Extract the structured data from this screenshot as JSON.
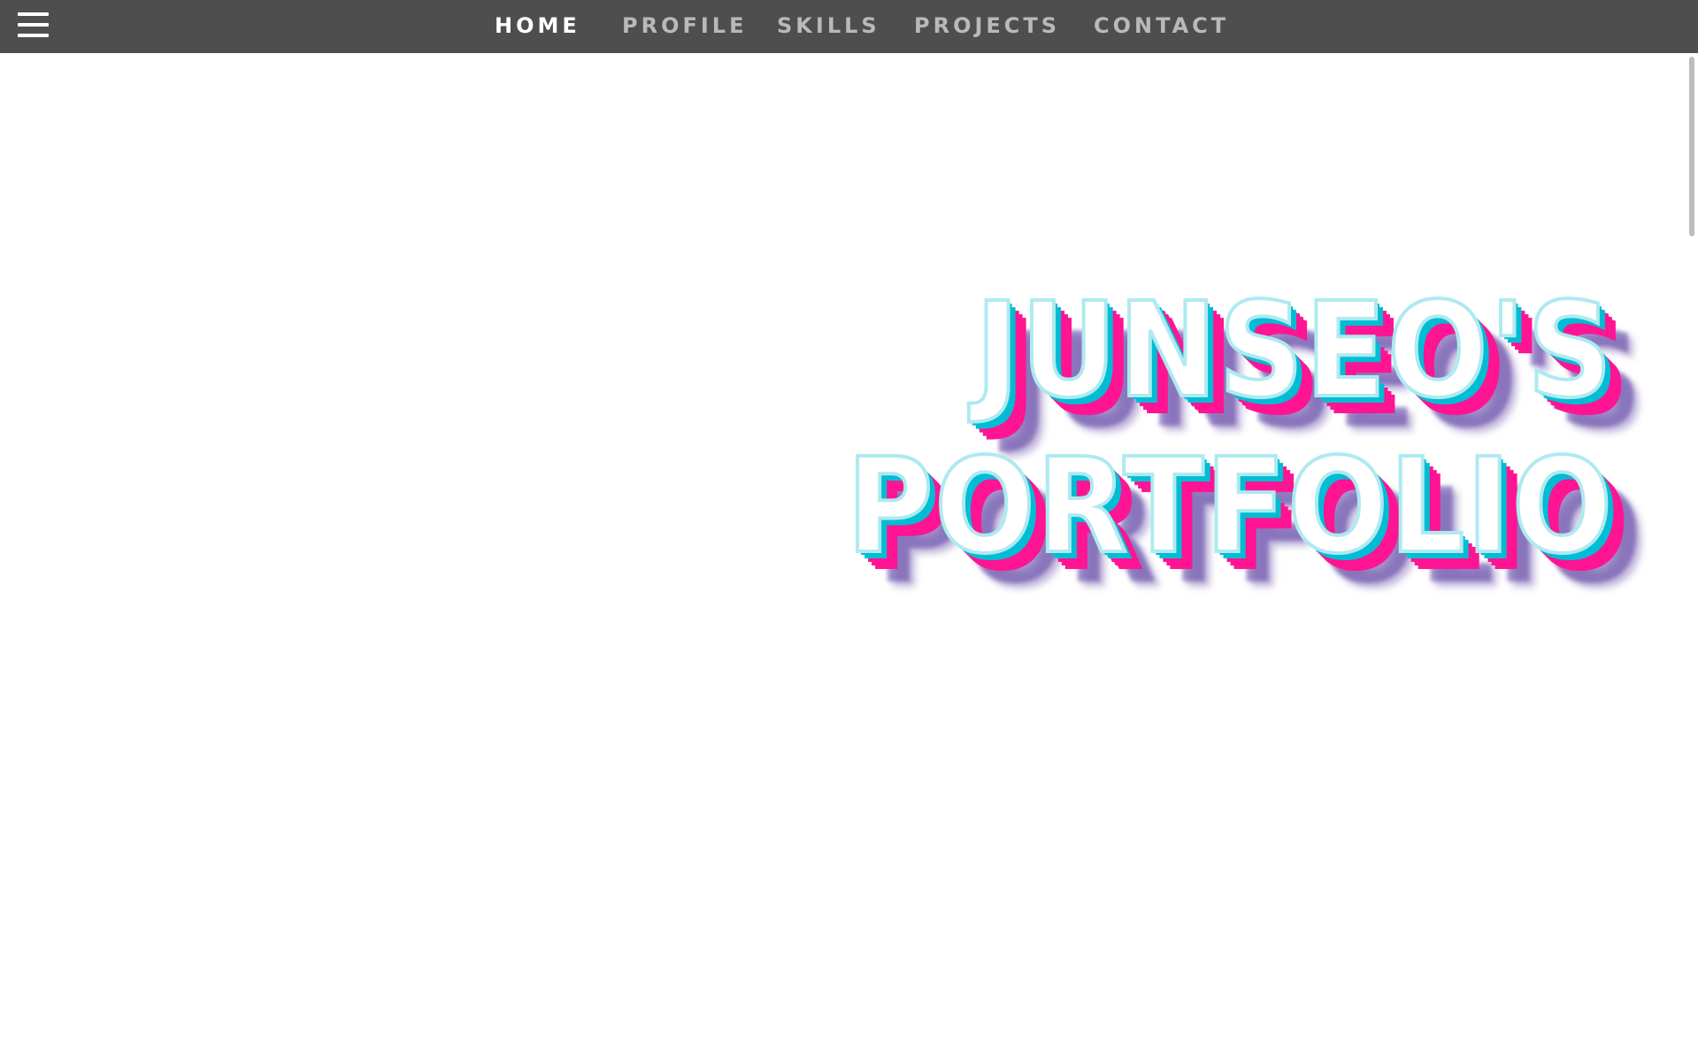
{
  "nav": {
    "menu_icon": "hamburger-icon",
    "links": [
      {
        "label": "HOME",
        "active": true
      },
      {
        "label": "PROFILE",
        "active": false
      },
      {
        "label": "SKILLS",
        "active": false
      },
      {
        "label": "PROJECTS",
        "active": false
      },
      {
        "label": "CONTACT",
        "active": false
      }
    ]
  },
  "hero": {
    "line1": "JUNSEO'S",
    "line2": "PORTFOLIO"
  },
  "colors": {
    "navbar_bg": "#4e4e4e",
    "nav_active": "#ffffff",
    "nav_inactive": "#b9b9b9",
    "title_outline": "#aeeaef",
    "title_shadow_cyan": "#00bcd4",
    "title_shadow_pink": "#ff1493",
    "title_shadow_purple": "#5a3ca0"
  }
}
